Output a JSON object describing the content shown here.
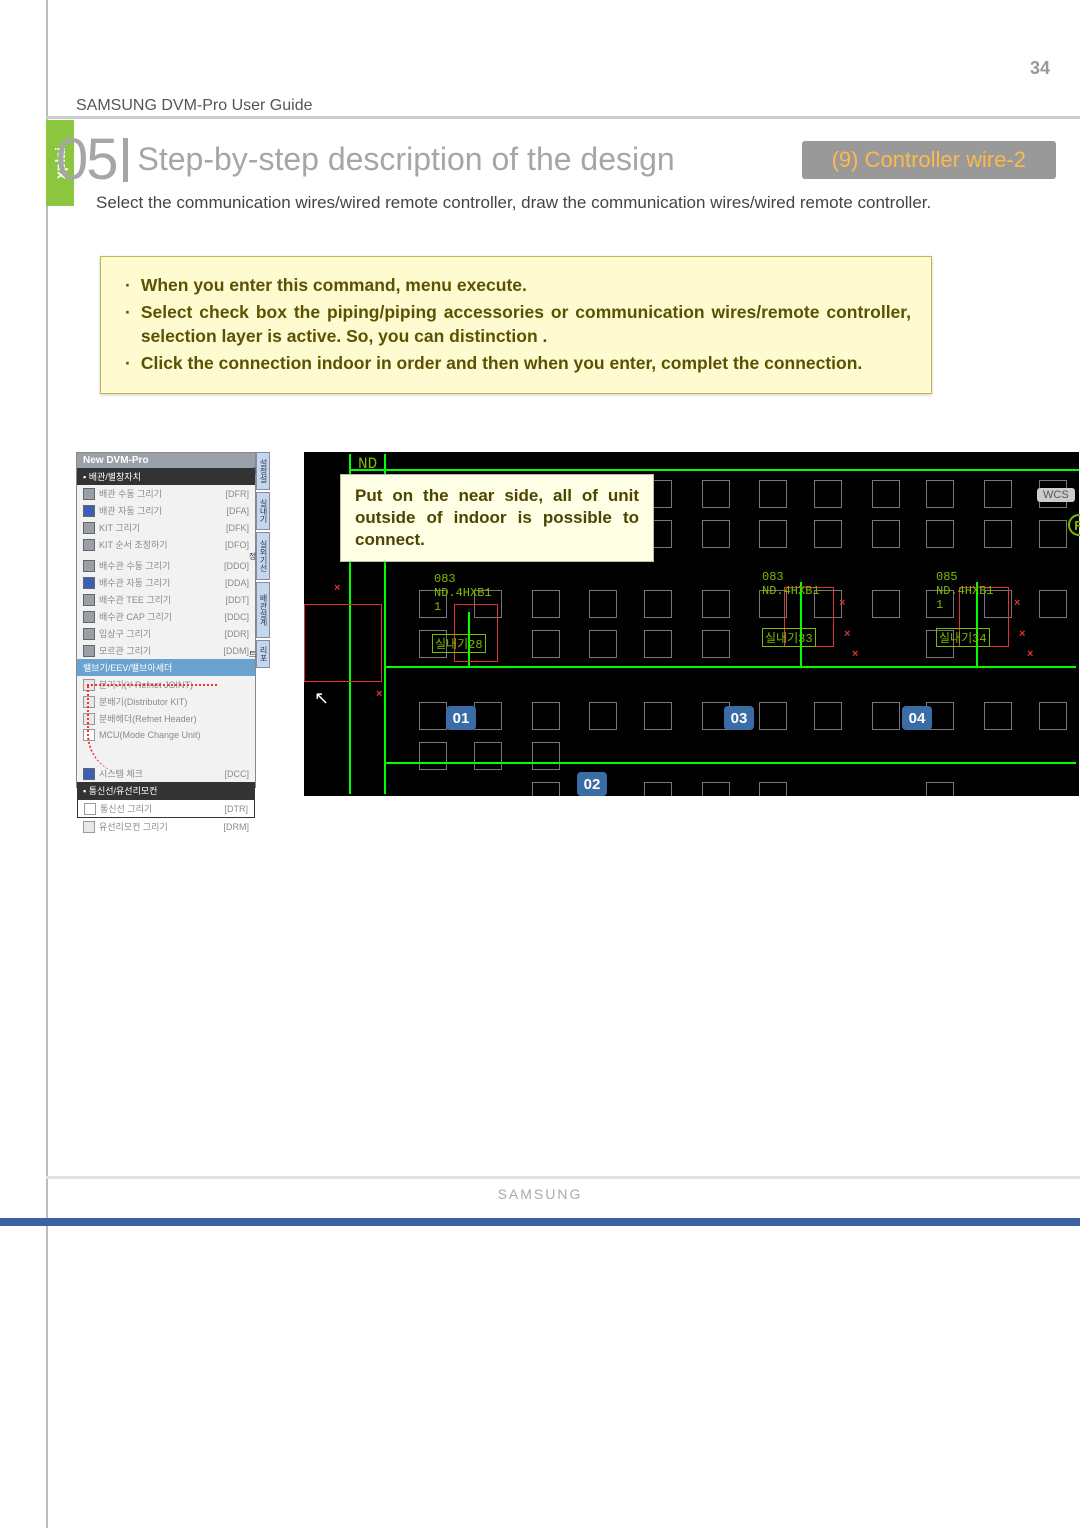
{
  "page_number": "34",
  "header_small": "SAMSUNG DVM-Pro User Guide",
  "section_number": "05",
  "section_title": "Step-by-step description of the design",
  "badge": "(9) Controller wire-2",
  "explain_tab": "xplai",
  "description": "Select the communication wires/wired remote controller, draw the communication wires/wired remote controller.",
  "tips": [
    "When you enter this command, menu execute.",
    "Select check box the piping/piping accessories or communication wires/remote controller, selection layer is active. So, you can distinction .",
    "Click the connection indoor in order and then when you enter, complet the connection."
  ],
  "highlight_note": "Put on the near side, all of unit outside of indoor is possible to connect.",
  "panel": {
    "title": "New DVM-Pro",
    "section1": "▪ 배관/별창자치",
    "rows1": [
      {
        "label": "배관 수동 그리기",
        "code": "[DFR]"
      },
      {
        "label": "배관 자동 그리기",
        "code": "[DFA]"
      },
      {
        "label": "KIT 그리기",
        "code": "[DFK]"
      },
      {
        "label": "KIT 순서 조정하기",
        "code": "[DFO]"
      }
    ],
    "rows2": [
      {
        "label": "배수관 수동 그리기",
        "code": "[DDO]"
      },
      {
        "label": "배수관 자동 그리기",
        "code": "[DDA]"
      },
      {
        "label": "배수관 TEE 그리기",
        "code": "[DDT]"
      },
      {
        "label": "배수관 CAP 그리기",
        "code": "[DDC]"
      },
      {
        "label": "입상구 그리기",
        "code": "[DDR]"
      },
      {
        "label": "모르관 그리기",
        "code": "[DDM]"
      }
    ],
    "dropdown": "밸브기/EEV/밸브아세더",
    "extras": [
      "분기기(Y-Refnet JOINT)",
      "분배기(Distributor KIT)",
      "분배헤더(Refnet Header)",
      "MCU(Mode Change Unit)"
    ],
    "syscheck": {
      "label": "시스템 체크",
      "code": "[DCC]"
    },
    "section2": "▪ 통신선/유선리모컨",
    "rows3": [
      {
        "label": "통신선 그리기",
        "code": "[DTR]"
      },
      {
        "label": "유선리모컨 그리기",
        "code": "[DRM]"
      }
    ]
  },
  "cad": {
    "nd_top": "ND",
    "wcs": "WCS",
    "r": "R",
    "label1": "083",
    "label1b": "ND.4HXB1",
    "label1c": "1",
    "label2": "실내기28",
    "label3": "083",
    "label3b": "ND.4HXB1",
    "label4": "실내기33",
    "label5": "085",
    "label5b": "ND.4HXB1",
    "label5c": "1",
    "label6": "실내기34",
    "badges": {
      "b1": "01",
      "b2": "02",
      "b3": "03",
      "b4": "04"
    }
  },
  "footer_brand": "SAMSUNG",
  "dot": "·"
}
